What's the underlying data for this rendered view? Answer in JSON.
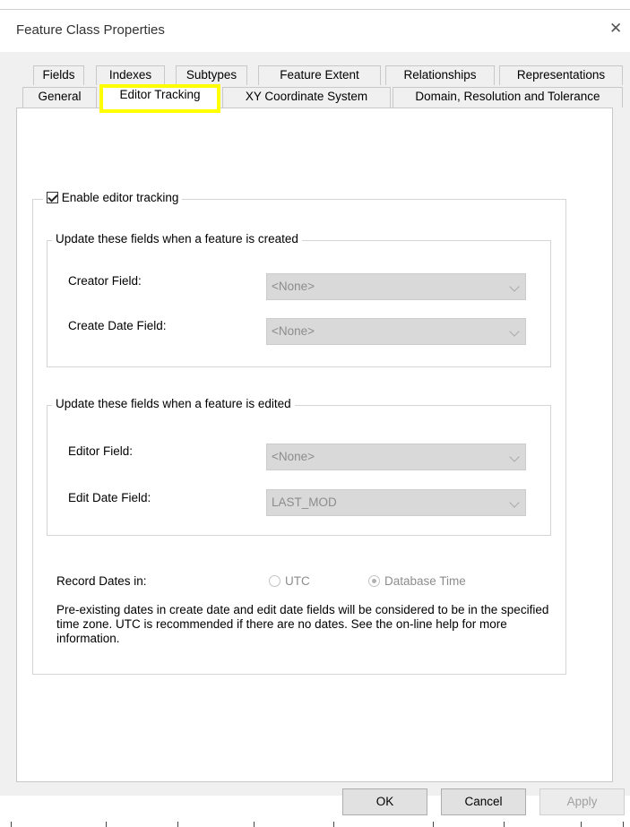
{
  "window": {
    "title": "Feature Class Properties",
    "close_glyph": "✕"
  },
  "tabs": {
    "row1": [
      "Fields",
      "Indexes",
      "Subtypes",
      "Feature Extent",
      "Relationships",
      "Representations"
    ],
    "row2": [
      "General",
      "Editor Tracking",
      "XY Coordinate System",
      "Domain, Resolution and Tolerance"
    ],
    "active": "Editor Tracking"
  },
  "editor_tracking": {
    "enable_label": "Enable editor tracking",
    "enable_checked": true,
    "created_group": {
      "legend": "Update these fields when a feature is created",
      "creator_label": "Creator Field:",
      "creator_value": "<None>",
      "create_date_label": "Create Date Field:",
      "create_date_value": "<None>"
    },
    "edited_group": {
      "legend": "Update these fields when a feature is edited",
      "editor_label": "Editor Field:",
      "editor_value": "<None>",
      "edit_date_label": "Edit Date Field:",
      "edit_date_value": "LAST_MOD"
    },
    "record_dates_label": "Record Dates in:",
    "radio_utc": "UTC",
    "radio_database": "Database Time",
    "selected_radio": "Database Time",
    "note": "Pre-existing dates in create date and edit date fields will be considered to be in the specified time zone. UTC is recommended if there are no dates. See the on-line help for more information."
  },
  "buttons": {
    "ok": "OK",
    "cancel": "Cancel",
    "apply": "Apply"
  },
  "colors": {
    "highlight": "#ffff00",
    "dialog_background": "#f0f0f0",
    "disabled_combo": "#d9d9d9"
  }
}
